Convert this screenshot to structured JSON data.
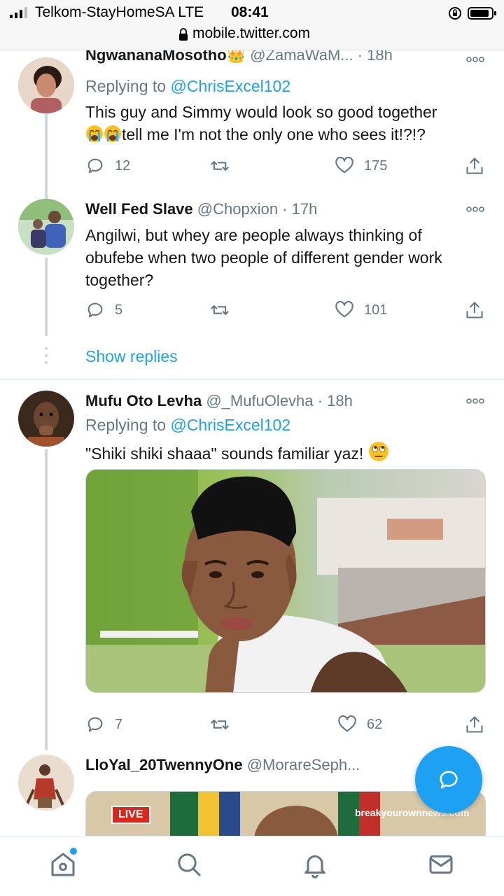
{
  "status_bar": {
    "carrier": "Telkom-StayHomeSA  LTE",
    "time": "08:41"
  },
  "url_bar": {
    "url": "mobile.twitter.com"
  },
  "tweets": [
    {
      "name": "NgwananaMosotho👑",
      "handle": "@ZamaWaM...",
      "time": "· 18h",
      "replying_label": "Replying to",
      "replying_to": "@ChrisExcel102",
      "text_line1": "This guy and Simmy would look so good together",
      "text_line2": "tell me I'm not the only one who sees it!?!?",
      "emoji": "loudly-crying-face",
      "replies": "12",
      "retweets": "",
      "likes": "175"
    },
    {
      "name": "Well Fed Slave",
      "handle": "@Chopxion",
      "time": "· 17h",
      "text": "Angilwi, but whey are people always thinking of obufebe when two people of different gender work together?",
      "replies": "5",
      "retweets": "",
      "likes": "101"
    },
    {
      "name": "Mufu Oto Levha",
      "handle": "@_MufuOlevha",
      "time": "· 18h",
      "replying_label": "Replying to",
      "replying_to": "@ChrisExcel102",
      "text": "\"Shiki shiki shaaa\" sounds familiar yaz!",
      "emoji": "face-with-rolling-eyes",
      "replies": "7",
      "retweets": "",
      "likes": "62"
    },
    {
      "name": "LloYal_20TwennyOne",
      "handle": "@MorareSeph...",
      "media_live": "LIVE",
      "media_watermark": "breakyourownnews.com"
    }
  ],
  "show_replies": "Show replies",
  "colors": {
    "accent": "#1da1f2",
    "muted": "#657786",
    "line": "#ccd6dd"
  },
  "bottom_nav": [
    "home-icon",
    "search-icon",
    "notifications-icon",
    "messages-icon"
  ]
}
